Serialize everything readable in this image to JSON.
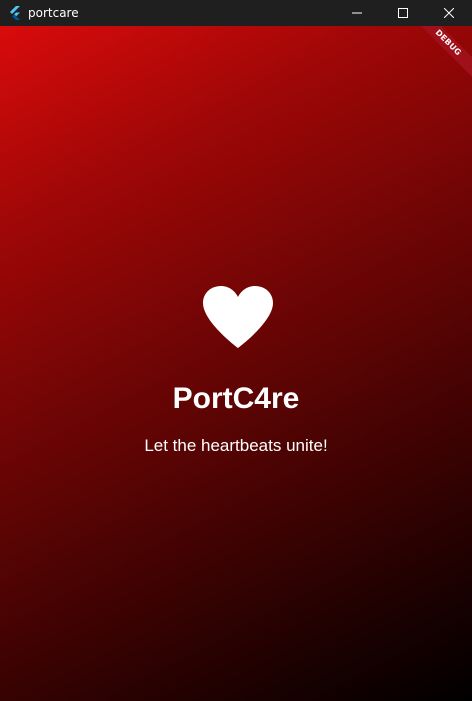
{
  "window": {
    "title": "portcare",
    "app_icon": "flutter-icon",
    "controls": [
      "minimize-icon",
      "maximize-icon",
      "close-icon"
    ]
  },
  "debug_banner": {
    "label": "DEBUG",
    "color": "#a0101a"
  },
  "splash": {
    "icon": "heart-icon",
    "app_name": "PortC4re",
    "tagline": "Let the heartbeats unite!",
    "gradient_start": "#d90b0b",
    "gradient_end": "#000000",
    "text_color": "#ffffff"
  }
}
